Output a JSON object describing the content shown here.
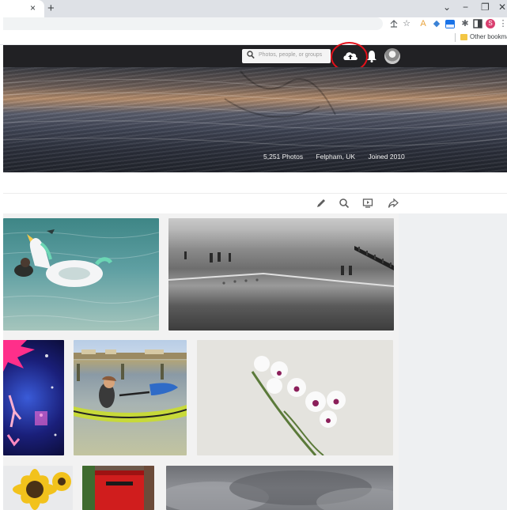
{
  "browser": {
    "tab_close": "×",
    "new_tab": "+",
    "window_controls": [
      "⌄",
      "−",
      "❐",
      "✕"
    ],
    "bookmarks": {
      "other_label": "Other bookmarks"
    },
    "profile_initial": "S"
  },
  "header": {
    "search_placeholder": "Photos, people, or groups",
    "icons": [
      "search-icon",
      "upload-icon",
      "bell-icon",
      "avatar"
    ]
  },
  "profile": {
    "stats": {
      "photos": "5,251 Photos",
      "location": "Felpham, UK",
      "joined": "Joined 2010"
    }
  },
  "subtoolbar": {
    "icons": [
      "pencil-icon",
      "search-icon",
      "slideshow-icon",
      "share-icon"
    ]
  },
  "photos": [
    {
      "subject": "unicorn-inflatable-sea"
    },
    {
      "subject": "black-white-beach-groynes"
    },
    {
      "subject": "circus-performer"
    },
    {
      "subject": "girl-kayak"
    },
    {
      "subject": "white-orchid"
    },
    {
      "subject": "sunflower"
    },
    {
      "subject": "red-postbox"
    },
    {
      "subject": "grey-clouds"
    }
  ],
  "colors": {
    "header_bg": "#212124",
    "highlight_ring": "#e3101a",
    "tab_bg": "#dee1e6"
  }
}
